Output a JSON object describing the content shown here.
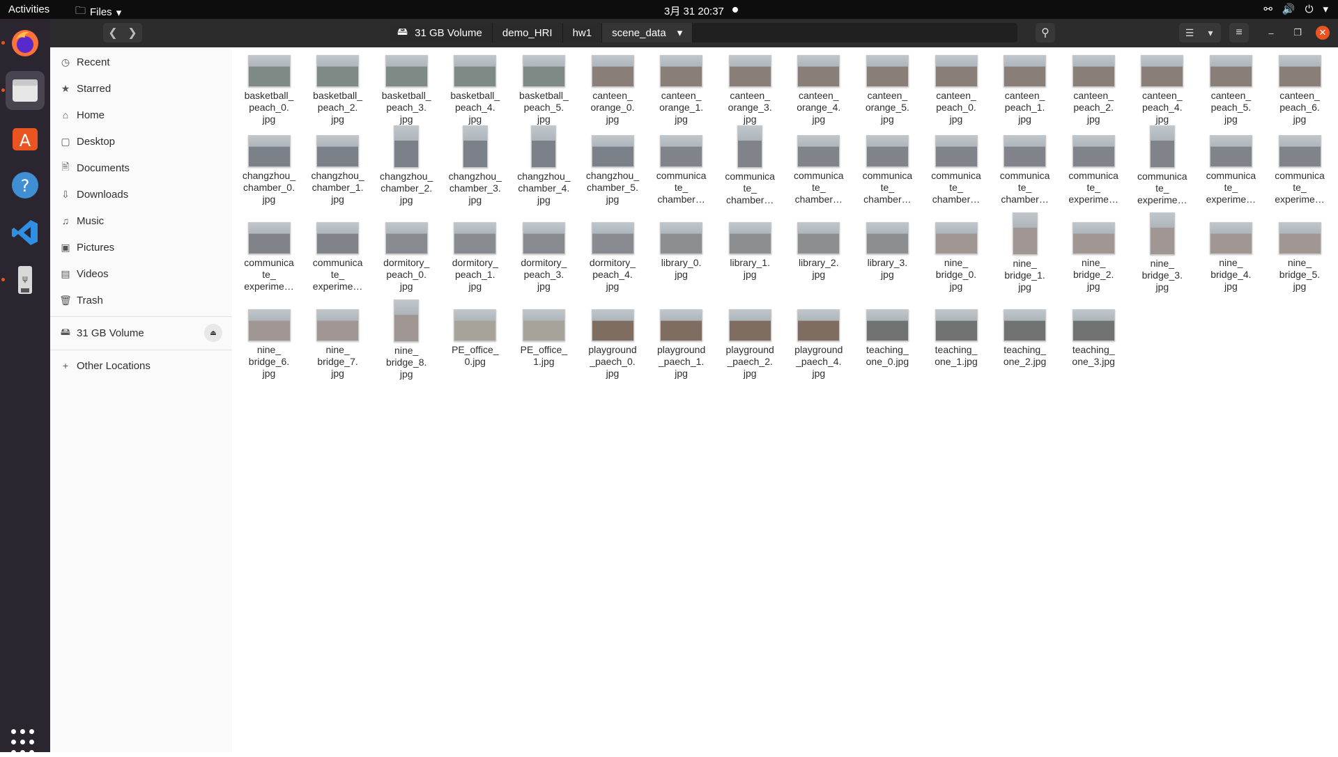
{
  "topbar": {
    "activities": "Activities",
    "app_name": "Files",
    "clock": "3月 31  20:37"
  },
  "dock": {
    "apps": [
      "firefox-icon",
      "files-icon",
      "ubuntu-software-icon",
      "help-icon",
      "vscode-icon",
      "usb-drive-icon"
    ]
  },
  "header": {
    "path": [
      "31 GB Volume",
      "demo_HRI",
      "hw1",
      "scene_data"
    ]
  },
  "sidebar": {
    "items": [
      {
        "label": "Recent",
        "icon": "clock-icon"
      },
      {
        "label": "Starred",
        "icon": "star-icon"
      },
      {
        "label": "Home",
        "icon": "home-icon"
      },
      {
        "label": "Desktop",
        "icon": "desktop-icon"
      },
      {
        "label": "Documents",
        "icon": "documents-icon"
      },
      {
        "label": "Downloads",
        "icon": "download-icon"
      },
      {
        "label": "Music",
        "icon": "music-icon"
      },
      {
        "label": "Pictures",
        "icon": "pictures-icon"
      },
      {
        "label": "Videos",
        "icon": "videos-icon"
      },
      {
        "label": "Trash",
        "icon": "trash-icon"
      }
    ],
    "volume": "31 GB Volume",
    "other_locations": "Other Locations"
  },
  "files": [
    "basketball_\npeach_0.\njpg",
    "basketball_\npeach_2.\njpg",
    "basketball_\npeach_3.\njpg",
    "basketball_\npeach_4.\njpg",
    "basketball_\npeach_5.\njpg",
    "canteen_\norange_0.\njpg",
    "canteen_\norange_1.\njpg",
    "canteen_\norange_3.\njpg",
    "canteen_\norange_4.\njpg",
    "canteen_\norange_5.\njpg",
    "canteen_\npeach_0.\njpg",
    "canteen_\npeach_1.\njpg",
    "canteen_\npeach_2.\njpg",
    "canteen_\npeach_4.\njpg",
    "canteen_\npeach_5.\njpg",
    "canteen_\npeach_6.\njpg",
    "changzhou_\nchamber_0.\njpg",
    "changzhou_\nchamber_1.\njpg",
    "changzhou_\nchamber_2.\njpg",
    "changzhou_\nchamber_3.\njpg",
    "changzhou_\nchamber_4.\njpg",
    "changzhou_\nchamber_5.\njpg",
    "communica\nte_\nchamber…",
    "communica\nte_\nchamber…",
    "communica\nte_\nchamber…",
    "communica\nte_\nchamber…",
    "communica\nte_\nchamber…",
    "communica\nte_\nchamber…",
    "communica\nte_\nexperime…",
    "communica\nte_\nexperime…",
    "communica\nte_\nexperime…",
    "communica\nte_\nexperime…",
    "communica\nte_\nexperime…",
    "communica\nte_\nexperime…",
    "dormitory_\npeach_0.\njpg",
    "dormitory_\npeach_1.\njpg",
    "dormitory_\npeach_3.\njpg",
    "dormitory_\npeach_4.\njpg",
    "library_0.\njpg",
    "library_1.\njpg",
    "library_2.\njpg",
    "library_3.\njpg",
    "nine_\nbridge_0.\njpg",
    "nine_\nbridge_1.\njpg",
    "nine_\nbridge_2.\njpg",
    "nine_\nbridge_3.\njpg",
    "nine_\nbridge_4.\njpg",
    "nine_\nbridge_5.\njpg",
    "nine_\nbridge_6.\njpg",
    "nine_\nbridge_7.\njpg",
    "nine_\nbridge_8.\njpg",
    "PE_office_\n0.jpg",
    "PE_office_\n1.jpg",
    "playground\n_paech_0.\njpg",
    "playground\n_paech_1.\njpg",
    "playground\n_paech_2.\njpg",
    "playground\n_paech_4.\njpg",
    "teaching_\none_0.jpg",
    "teaching_\none_1.jpg",
    "teaching_\none_2.jpg",
    "teaching_\none_3.jpg"
  ],
  "thumb_colors": {
    "basketball": "#7d8a86",
    "canteen": "#8a7f78",
    "changzhou": "#7c8088",
    "communicate": "#80848a",
    "dormitory": "#888b90",
    "library": "#8c8e8f",
    "nine": "#a09794",
    "PE": "#a7a39a",
    "playground": "#7e6d60",
    "teaching": "#707371"
  }
}
